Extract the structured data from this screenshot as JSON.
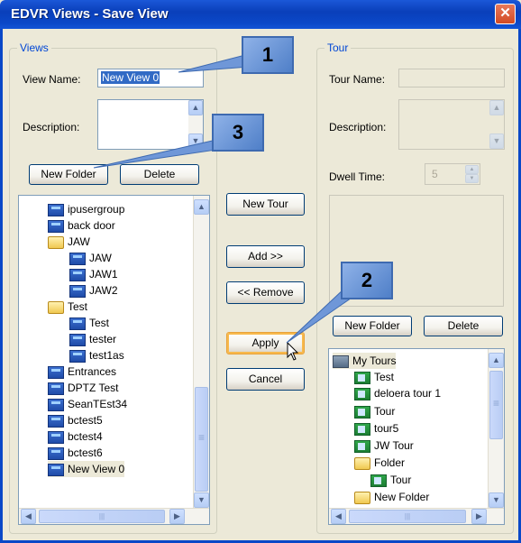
{
  "window": {
    "title": "EDVR Views - Save View",
    "close_glyph": "✕"
  },
  "views_group": {
    "legend": "Views",
    "view_name_label": "View Name:",
    "view_name_value": "New View 0",
    "description_label": "Description:",
    "new_folder_label": "New Folder",
    "delete_label": "Delete",
    "tree": [
      {
        "label": "ipusergroup",
        "icon": "view"
      },
      {
        "label": "back door",
        "icon": "view"
      },
      {
        "label": "JAW",
        "icon": "folder"
      },
      {
        "label": "JAW",
        "icon": "view"
      },
      {
        "label": "JAW1",
        "icon": "view"
      },
      {
        "label": "JAW2",
        "icon": "view"
      },
      {
        "label": "Test",
        "icon": "folder"
      },
      {
        "label": "Test",
        "icon": "view"
      },
      {
        "label": "tester",
        "icon": "view"
      },
      {
        "label": "test1as",
        "icon": "view"
      },
      {
        "label": "Entrances",
        "icon": "view"
      },
      {
        "label": "DPTZ Test",
        "icon": "view"
      },
      {
        "label": "SeanTEst34",
        "icon": "view"
      },
      {
        "label": "bctest5",
        "icon": "view"
      },
      {
        "label": "bctest4",
        "icon": "view"
      },
      {
        "label": "bctest6",
        "icon": "view"
      },
      {
        "label": "New View 0",
        "icon": "view"
      }
    ]
  },
  "middle": {
    "new_tour_label": "New Tour",
    "add_label": "Add >>",
    "remove_label": "<< Remove",
    "apply_label": "Apply",
    "cancel_label": "Cancel"
  },
  "tour_group": {
    "legend": "Tour",
    "tour_name_label": "Tour Name:",
    "description_label": "Description:",
    "dwell_label": "Dwell Time:",
    "dwell_value": "5",
    "new_folder_label": "New Folder",
    "delete_label": "Delete",
    "tree": [
      {
        "label": "My Tours",
        "icon": "net"
      },
      {
        "label": "Test",
        "icon": "tour"
      },
      {
        "label": "deloera tour 1",
        "icon": "tour"
      },
      {
        "label": "Tour",
        "icon": "tour"
      },
      {
        "label": "tour5",
        "icon": "tour"
      },
      {
        "label": "JW Tour",
        "icon": "tour"
      },
      {
        "label": "Folder",
        "icon": "folder"
      },
      {
        "label": "Tour",
        "icon": "tour"
      },
      {
        "label": "New Folder",
        "icon": "folder"
      }
    ]
  },
  "callouts": [
    "1",
    "2",
    "3"
  ],
  "scroll_glyphs": {
    "up": "▲",
    "down": "▼",
    "left": "◀",
    "right": "▶",
    "grip": "≡",
    "hgrip": "|||"
  },
  "colors": {
    "title_bar": "#0a3fba",
    "legend": "#0046d5",
    "callout": "#6f97d8"
  }
}
